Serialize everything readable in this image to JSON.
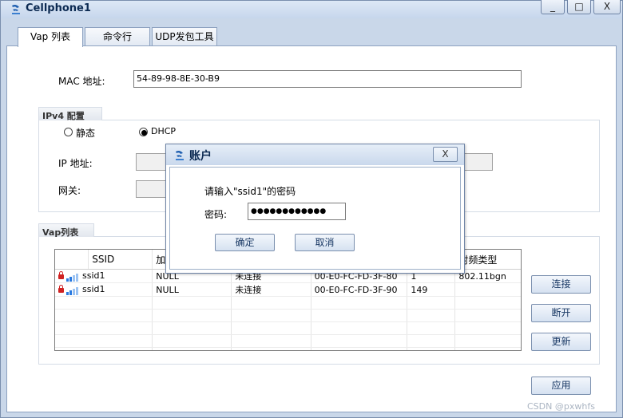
{
  "window": {
    "title": "Cellphone1",
    "minimize": "_",
    "maximize": "□",
    "close": "X"
  },
  "tabs": [
    {
      "label": "Vap 列表"
    },
    {
      "label": "命令行"
    },
    {
      "label": "UDP发包工具"
    }
  ],
  "mac": {
    "label": "MAC 地址:",
    "value": "54-89-98-8E-30-B9"
  },
  "ipv4": {
    "title": "IPv4 配置",
    "static_label": "静态",
    "dhcp_label": "DHCP",
    "mode": "DHCP",
    "ip_label": "IP 地址:",
    "gateway_label": "网关:"
  },
  "vap": {
    "title": "Vap列表",
    "columns": [
      "SSID",
      "加",
      "",
      "",
      "",
      "射频类型"
    ],
    "rows": [
      {
        "ssid": "ssid1",
        "enc": "NULL",
        "status": "未连接",
        "mac": "00-E0-FC-FD-3F-80",
        "channel": "1",
        "radio": "802.11bgn"
      },
      {
        "ssid": "ssid1",
        "enc": "NULL",
        "status": "未连接",
        "mac": "00-E0-FC-FD-3F-90",
        "channel": "149",
        "radio": ""
      }
    ],
    "connect": "连接",
    "disconnect": "断开",
    "refresh": "更新"
  },
  "apply": "应用",
  "dialog": {
    "title": "账户",
    "close": "X",
    "prompt": "请输入\"ssid1\"的密码",
    "password_label": "密码:",
    "password_value": "●●●●●●●●●●●●",
    "ok": "确定",
    "cancel": "取消"
  },
  "watermark": "CSDN @pxwhfs",
  "colors": {
    "accent": "#2a7ae0",
    "lock": "#d02222",
    "title_text": "#0c2a52"
  }
}
